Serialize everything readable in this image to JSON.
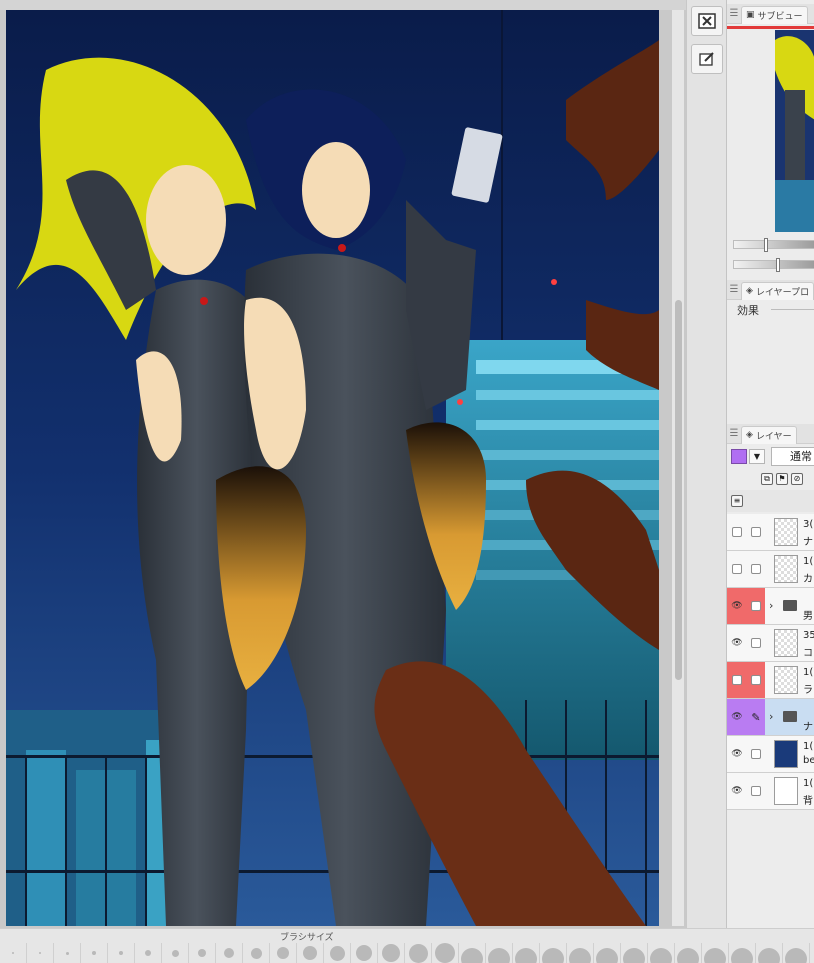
{
  "toolbar": {
    "buttons": [
      {
        "name": "delete-layer-icon"
      },
      {
        "name": "edit-icon"
      }
    ]
  },
  "subview_panel": {
    "tab_label": "サブビュー"
  },
  "layer_property_panel": {
    "tab_label": "レイヤープロ",
    "effects_label": "効果"
  },
  "layer_panel": {
    "tab_label": "レイヤー",
    "blend_mode": "通常",
    "layers": [
      {
        "line1": "3(",
        "line2": "ナ",
        "type": "raster",
        "eye": false,
        "lock_color": "",
        "selected": false
      },
      {
        "line1": "1(",
        "line2": "カ",
        "type": "raster",
        "eye": false,
        "lock_color": "",
        "selected": false
      },
      {
        "line1": "",
        "line2": "男",
        "type": "folder",
        "eye": true,
        "lock_color": "red",
        "selected": false
      },
      {
        "line1": "35",
        "line2": "コ",
        "type": "raster",
        "eye": true,
        "lock_color": "",
        "selected": false
      },
      {
        "line1": "1(",
        "line2": "ラ",
        "type": "raster",
        "eye": false,
        "lock_color": "red",
        "selected": false
      },
      {
        "line1": "",
        "line2": "ナ",
        "type": "folder",
        "eye": true,
        "lock_color": "purple",
        "selected": true
      },
      {
        "line1": "1(",
        "line2": "be",
        "type": "image",
        "eye": true,
        "lock_color": "",
        "selected": false
      },
      {
        "line1": "1(",
        "line2": "背",
        "type": "paper",
        "eye": true,
        "lock_color": "",
        "selected": false
      }
    ]
  },
  "brush_bar": {
    "title": "ブラシサイズ",
    "sizes": [
      0.05,
      0.08,
      0.12,
      0.16,
      0.2,
      0.26,
      0.32,
      0.38,
      0.44,
      0.5,
      0.56,
      0.62,
      0.68,
      0.74,
      0.8,
      0.86,
      0.92,
      1.0,
      1.0,
      1.0,
      1.0,
      1.0,
      1.0,
      1.0,
      1.0,
      1.0,
      1.0,
      1.0,
      1.0,
      1.0
    ]
  },
  "colors": {
    "accent_red": "#e23a3a",
    "layer_color_purple": "#b06ef2",
    "selected_row": "#c9ddf2"
  }
}
